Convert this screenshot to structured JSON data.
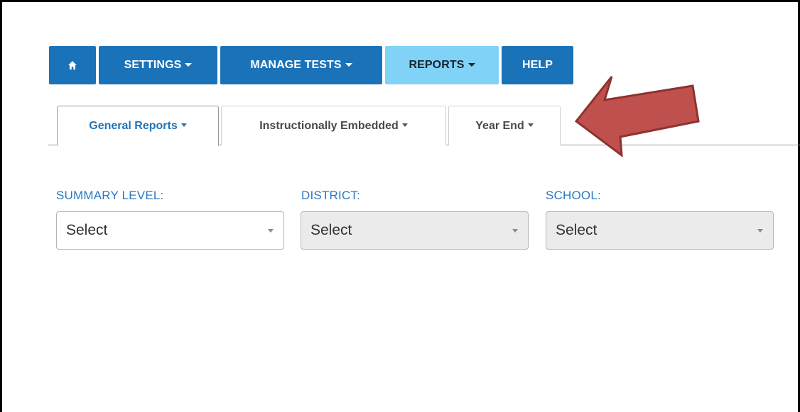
{
  "nav": {
    "home_icon": "home-icon",
    "settings_label": "SETTINGS",
    "manage_tests_label": "MANAGE TESTS",
    "reports_label": "REPORTS",
    "help_label": "HELP"
  },
  "tabs": [
    {
      "label": "General Reports",
      "active": true
    },
    {
      "label": "Instructionally Embedded",
      "active": false
    },
    {
      "label": "Year End",
      "active": false
    }
  ],
  "filters": {
    "summary_level": {
      "label": "SUMMARY LEVEL:",
      "value": "Select"
    },
    "district": {
      "label": "DISTRICT:",
      "value": "Select"
    },
    "school": {
      "label": "SCHOOL:",
      "value": "Select"
    }
  },
  "colors": {
    "nav_blue": "#1a72b8",
    "nav_active": "#80d2f7",
    "label_blue": "#2b78c2",
    "arrow_red": "#c0504d"
  }
}
